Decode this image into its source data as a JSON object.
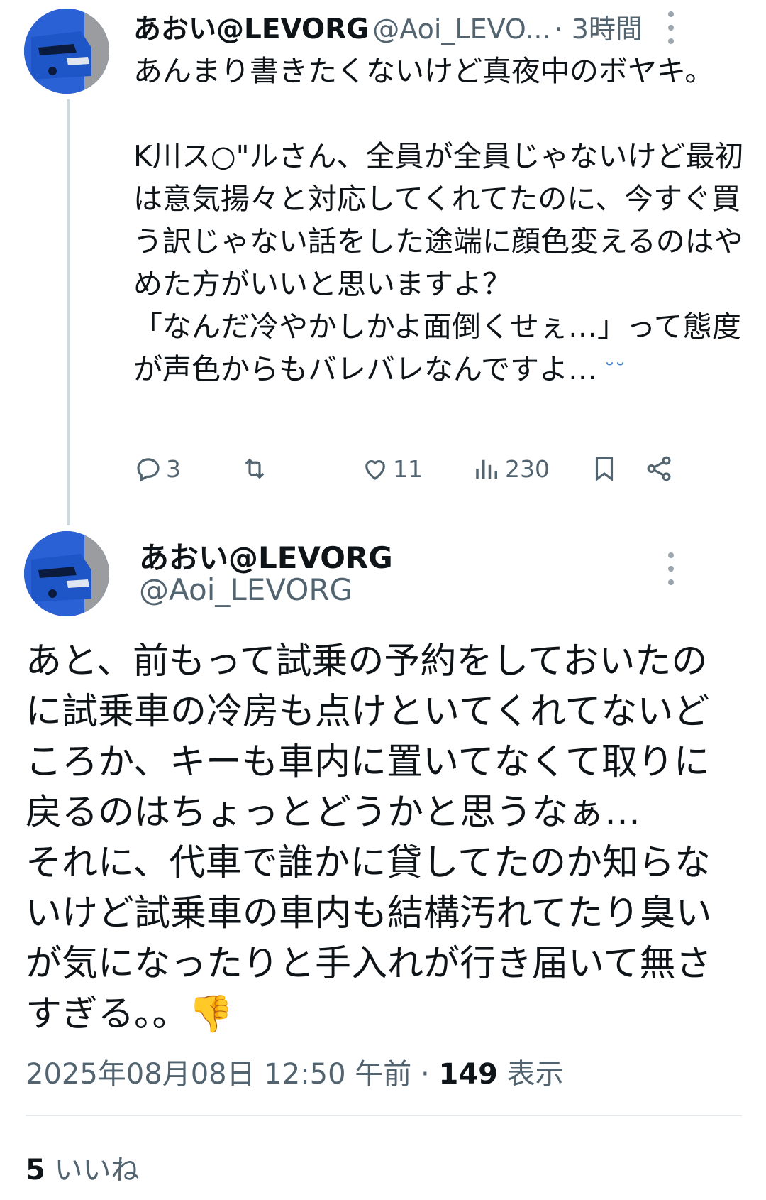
{
  "tweet1": {
    "display_name": "あおい@LEVORG",
    "handle": "@Aoi_LEVO...",
    "time": "· 3時間",
    "text": "あんまり書きたくないけど真夜中のボヤキ。\n\nK川ス○\"ルさん、全員が全員じゃないけど最初は意気揚々と対応してくれてたのに、今すぐ買う訳じゃない話をした途端に顔色変えるのはやめた方がいいと思いますよ？\n「なんだ冷やかしかよ面倒くせぇ…」って態度が声色からもバレバレなんですよ…",
    "emoji": "˘˘",
    "actions": {
      "replies": "3",
      "retweets": "",
      "likes": "11",
      "views": "230"
    }
  },
  "tweet2": {
    "display_name": "あおい@LEVORG",
    "handle": "@Aoi_LEVORG",
    "text": "あと、前もって試乗の予約をしておいたのに試乗車の冷房も点けといてくれてないどころか、キーも車内に置いてなくて取りに戻るのはちょっとどうかと思うなぁ…\nそれに、代車で誰かに貸してたのか知らないけど試乗車の車内も結構汚れてたり臭いが気になったりと手入れが行き届いて無さすぎる。。",
    "emoji": "👎",
    "timestamp": "2025年08月08日 12:50 午前",
    "separator": " · ",
    "views_count": "149",
    "views_label": " 表示",
    "likes_count": "5",
    "likes_label": " いいね"
  },
  "colors": {
    "text": "#0f1419",
    "secondary": "#536471",
    "thread_line": "#cfd9de",
    "avatar_blue": "#1b4fb8"
  }
}
